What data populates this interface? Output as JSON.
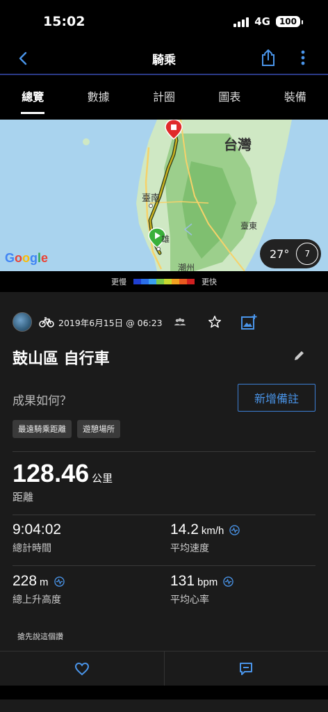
{
  "status_bar": {
    "time": "15:02",
    "network": "4G",
    "battery": "100"
  },
  "nav": {
    "title": "騎乘",
    "back_icon": "chevron-left-icon",
    "share_icon": "share-icon",
    "more_icon": "more-vertical-icon"
  },
  "tabs": [
    {
      "label": "總覽",
      "active": true
    },
    {
      "label": "數據",
      "active": false
    },
    {
      "label": "計圈",
      "active": false
    },
    {
      "label": "圖表",
      "active": false
    },
    {
      "label": "裝備",
      "active": false
    }
  ],
  "map": {
    "labels": {
      "taiwan": "台灣",
      "tainan": "臺南",
      "taitung": "臺東",
      "kaohsiung": "雄",
      "chaozhou": "潮州"
    },
    "attribution": "Google",
    "weather": {
      "temperature": "27°",
      "wind": "7"
    }
  },
  "speed_legend": {
    "slower": "更慢",
    "faster": "更快",
    "colors": [
      "#1f3fd0",
      "#2a6ee8",
      "#3aa0f0",
      "#7cc84a",
      "#c8d830",
      "#f0a020",
      "#e85a20",
      "#d02020"
    ]
  },
  "activity": {
    "date": "2019年6月15日 @ 06:23",
    "title": "鼓山區 自行車",
    "how_label": "成果如何？",
    "add_note": "新增備註",
    "tags": [
      "最遠騎乘距離",
      "遊憩場所"
    ]
  },
  "stats": {
    "distance": {
      "value": "128.46",
      "unit": "公里",
      "label": "距離"
    },
    "total_time": {
      "value": "9:04:02",
      "label": "總計時間"
    },
    "avg_speed": {
      "value": "14.2",
      "unit": "km/h",
      "label": "平均速度"
    },
    "elevation_gain": {
      "value": "228",
      "unit": "m",
      "label": "總上升高度"
    },
    "avg_hr": {
      "value": "131",
      "unit": "bpm",
      "label": "平均心率"
    }
  },
  "social": {
    "first_comment": "搶先說這個讚"
  }
}
